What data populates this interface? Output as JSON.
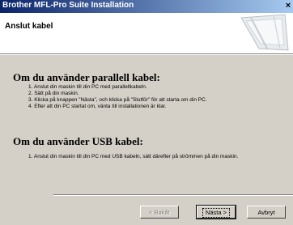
{
  "window": {
    "title": "Brother MFL-Pro Suite Installation",
    "close_glyph": "×"
  },
  "header": {
    "title": "Anslut kabel"
  },
  "parallel": {
    "heading": "Om du använder parallell kabel:",
    "steps": [
      "1. Anslut din maskin till din PC med parallellkabeln.",
      "2. Sätt på din maskin.",
      "3. Klicka på knappen \"Nästa\", och klicka på \"Slutför\" för att starta om din PC.",
      "4. Efter att din PC startat om, vänta till installationen är klar."
    ]
  },
  "usb": {
    "heading": "Om du använder USB kabel:",
    "steps": [
      "1. Anslut din maskin till din PC med USB kabeln, sätt därefter på strömmen på din maskin."
    ]
  },
  "buttons": {
    "back": "< Bakåt",
    "next": "Nästa >",
    "cancel": "Avbryt"
  }
}
